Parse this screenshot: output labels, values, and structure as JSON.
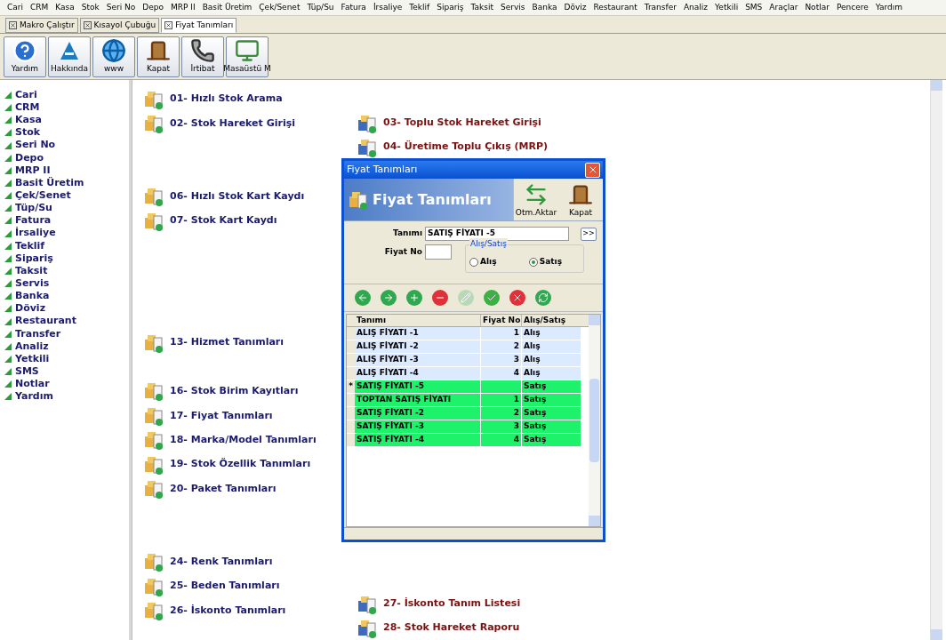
{
  "menu": [
    "Cari",
    "CRM",
    "Kasa",
    "Stok",
    "Seri No",
    "Depo",
    "MRP II",
    "Basit Üretim",
    "Çek/Senet",
    "Tüp/Su",
    "Fatura",
    "İrsaliye",
    "Teklif",
    "Sipariş",
    "Taksit",
    "Servis",
    "Banka",
    "Döviz",
    "Restaurant",
    "Transfer",
    "Analiz",
    "Yetkili",
    "SMS",
    "Araçlar",
    "Notlar",
    "Pencere",
    "Yardım"
  ],
  "tabs": [
    {
      "label": "Makro Çalıştır",
      "selected": false
    },
    {
      "label": "Kısayol Çubuğu",
      "selected": false
    },
    {
      "label": "Fiyat Tanımları",
      "selected": true
    }
  ],
  "toolbar": [
    {
      "label": "Yardım",
      "kind": "help"
    },
    {
      "label": "Hakkında",
      "kind": "logo"
    },
    {
      "label": "www",
      "kind": "globe"
    },
    {
      "label": "Kapat",
      "kind": "door"
    },
    {
      "label": "İrtibat",
      "kind": "phone"
    },
    {
      "label": "Masaüstü M",
      "kind": "desktop"
    }
  ],
  "sidebar": {
    "items": [
      "Cari",
      "CRM",
      "Kasa",
      "Stok",
      "Seri No",
      "Depo",
      "MRP II",
      "Basit Üretim",
      "Çek/Senet",
      "Tüp/Su",
      "Fatura",
      "İrsaliye",
      "Teklif",
      "Sipariş",
      "Taksit",
      "Servis",
      "Banka",
      "Döviz",
      "Restaurant",
      "Transfer",
      "Analiz",
      "Yetkili",
      "SMS",
      "Notlar",
      "Yardım"
    ]
  },
  "shortcuts": {
    "left": [
      {
        "label": "01- Hızlı Stok Arama",
        "kind": "form"
      },
      {
        "label": "02- Stok Hareket Girişi",
        "kind": "form"
      },
      {
        "label": "06- Hızlı Stok Kart Kaydı",
        "kind": "form"
      },
      {
        "label": "07- Stok Kart Kaydı",
        "kind": "form"
      },
      {
        "label": "13- Hizmet Tanımları",
        "kind": "form"
      },
      {
        "label": "16- Stok Birim Kayıtları",
        "kind": "form"
      },
      {
        "label": "17- Fiyat Tanımları",
        "kind": "form"
      },
      {
        "label": "18- Marka/Model Tanımları",
        "kind": "form"
      },
      {
        "label": "19- Stok Özellik Tanımları",
        "kind": "form"
      },
      {
        "label": "20- Paket Tanımları",
        "kind": "form"
      },
      {
        "label": "24- Renk Tanımları",
        "kind": "form"
      },
      {
        "label": "25- Beden Tanımları",
        "kind": "form"
      },
      {
        "label": "26- İskonto Tanımları",
        "kind": "form"
      }
    ],
    "right": [
      {
        "label": "03- Toplu Stok Hareket Girişi",
        "kind": "report"
      },
      {
        "label": "04- Üretime Toplu Çıkış (MRP)",
        "kind": "report"
      },
      {
        "label": "27- İskonto Tanım Listesi",
        "kind": "report"
      },
      {
        "label": "28- Stok Hareket Raporu",
        "kind": "report"
      }
    ]
  },
  "dialog": {
    "title": "Fiyat Tanımları",
    "header": "Fiyat Tanımları",
    "header_buttons": [
      {
        "label": "Otm.Aktar",
        "kind": "transfer"
      },
      {
        "label": "Kapat",
        "kind": "door"
      }
    ],
    "tanimi": {
      "label": "Tanımı",
      "value": "SATIŞ FİYATI -5",
      "button": ">>"
    },
    "fiyat_no": {
      "label": "Fiyat No"
    },
    "group": {
      "title": "Alış/Satış",
      "options": [
        {
          "label": "Alış",
          "selected": false
        },
        {
          "label": "Satış",
          "selected": true
        }
      ]
    },
    "actions": [
      {
        "kind": "back",
        "color": "#2fa84f"
      },
      {
        "kind": "forward",
        "color": "#2fa84f"
      },
      {
        "kind": "add",
        "color": "#2fa84f"
      },
      {
        "kind": "remove",
        "color": "#e0303a"
      },
      {
        "kind": "edit",
        "color": "#b8d8b8"
      },
      {
        "kind": "confirm",
        "color": "#3cb043"
      },
      {
        "kind": "cancel",
        "color": "#e0303a"
      },
      {
        "kind": "refresh",
        "color": "#2fa84f"
      }
    ],
    "grid": {
      "columns": [
        "Tanımı",
        "Fiyat No",
        "Alış/Satış"
      ],
      "rows": [
        {
          "cells": [
            "ALIŞ FİYATI -1",
            "1",
            "Alış"
          ],
          "color": "#dbeaff"
        },
        {
          "cells": [
            "ALIŞ FİYATI -2",
            "2",
            "Alış"
          ],
          "color": "#dbeaff"
        },
        {
          "cells": [
            "ALIŞ FİYATI -3",
            "3",
            "Alış"
          ],
          "color": "#dbeaff"
        },
        {
          "cells": [
            "ALIŞ FİYATI -4",
            "4",
            "Alış"
          ],
          "color": "#dbeaff"
        },
        {
          "cells": [
            "SATIŞ FİYATI -5",
            "",
            "Satış"
          ],
          "color": "#1ef16a",
          "indicator": "*"
        },
        {
          "cells": [
            "TOPTAN SATIŞ FİYATI",
            "1",
            "Satış"
          ],
          "color": "#1ef16a"
        },
        {
          "cells": [
            "SATIŞ FİYATI -2",
            "2",
            "Satış"
          ],
          "color": "#1ef16a"
        },
        {
          "cells": [
            "SATIŞ FİYATI -3",
            "3",
            "Satış"
          ],
          "color": "#1ef16a"
        },
        {
          "cells": [
            "SATIŞ FİYATI -4",
            "4",
            "Satış"
          ],
          "color": "#1ef16a"
        }
      ]
    }
  }
}
